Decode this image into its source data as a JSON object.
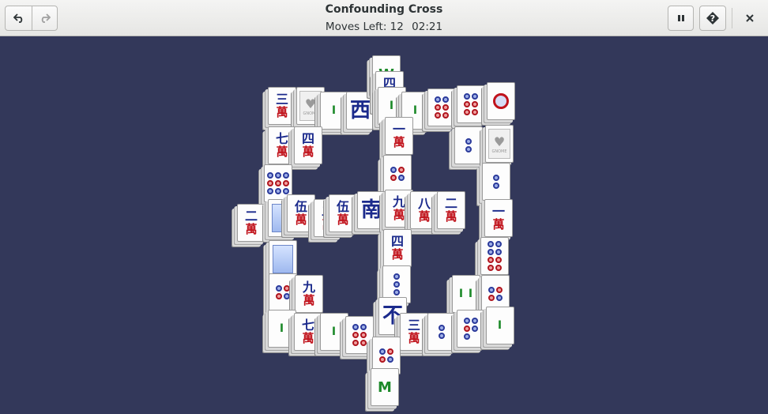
{
  "window": {
    "title": "Confounding Cross",
    "moves_label": "Moves Left: 12",
    "timer": "02:21"
  },
  "toolbar": {
    "undo_icon": "undo-icon",
    "redo_icon": "redo-icon",
    "pause_icon": "pause-icon",
    "hint_icon": "hint-icon",
    "close_icon": "close-icon"
  },
  "colors": {
    "board_background": "#33385a",
    "header_background": "#ecebea",
    "character_blue": "#1b2a8c",
    "character_red": "#c0121b",
    "bamboo_green": "#1d8a2a"
  },
  "tiles": [
    {
      "kind": "char",
      "num": "三",
      "wan": "萬"
    },
    {
      "kind": "gnome",
      "text": "GNOME"
    },
    {
      "kind": "bam",
      "text": "I"
    },
    {
      "kind": "big",
      "text": "西"
    },
    {
      "kind": "wind-g",
      "text": "W"
    },
    {
      "kind": "char",
      "num": "四",
      "wan": "萬"
    },
    {
      "kind": "bam",
      "text": "I"
    },
    {
      "kind": "bam",
      "text": "I"
    },
    {
      "kind": "circles",
      "n": 6
    },
    {
      "kind": "circles",
      "n": 6
    },
    {
      "kind": "ring"
    },
    {
      "kind": "char",
      "num": "七",
      "wan": "萬"
    },
    {
      "kind": "char",
      "num": "四",
      "wan": "萬"
    },
    {
      "kind": "circles",
      "n": 9
    },
    {
      "kind": "circles",
      "n": 2
    },
    {
      "kind": "gnome",
      "text": "GNOME"
    },
    {
      "kind": "char",
      "num": "一",
      "wan": "萬"
    },
    {
      "kind": "circles",
      "n": 4
    },
    {
      "kind": "circles",
      "n": 2
    },
    {
      "kind": "char",
      "num": "二",
      "wan": "萬"
    },
    {
      "kind": "flower"
    },
    {
      "kind": "char",
      "num": "伍",
      "wan": "萬"
    },
    {
      "kind": "char",
      "num": "二",
      "wan": "萬"
    },
    {
      "kind": "char",
      "num": "伍",
      "wan": "萬"
    },
    {
      "kind": "big",
      "text": "南"
    },
    {
      "kind": "char",
      "num": "九",
      "wan": "萬"
    },
    {
      "kind": "char",
      "num": "八",
      "wan": "萬"
    },
    {
      "kind": "char",
      "num": "二",
      "wan": "萬"
    },
    {
      "kind": "char",
      "num": "一",
      "wan": "萬"
    },
    {
      "kind": "flower"
    },
    {
      "kind": "char",
      "num": "四",
      "wan": "萬"
    },
    {
      "kind": "circles",
      "n": 8
    },
    {
      "kind": "circles",
      "n": 3
    },
    {
      "kind": "circles",
      "n": 4
    },
    {
      "kind": "char",
      "num": "九",
      "wan": "萬"
    },
    {
      "kind": "bam",
      "text": "I I"
    },
    {
      "kind": "circles",
      "n": 4
    },
    {
      "kind": "big",
      "text": "不"
    },
    {
      "kind": "char",
      "num": "三",
      "wan": "萬"
    },
    {
      "kind": "bam",
      "text": "I"
    },
    {
      "kind": "char",
      "num": "七",
      "wan": "萬"
    },
    {
      "kind": "bam",
      "text": "I"
    },
    {
      "kind": "circles",
      "n": 6
    },
    {
      "kind": "circles",
      "n": 2
    },
    {
      "kind": "circles",
      "n": 5
    },
    {
      "kind": "bam",
      "text": "I"
    },
    {
      "kind": "circles",
      "n": 4
    },
    {
      "kind": "wind-g",
      "text": "M"
    }
  ]
}
